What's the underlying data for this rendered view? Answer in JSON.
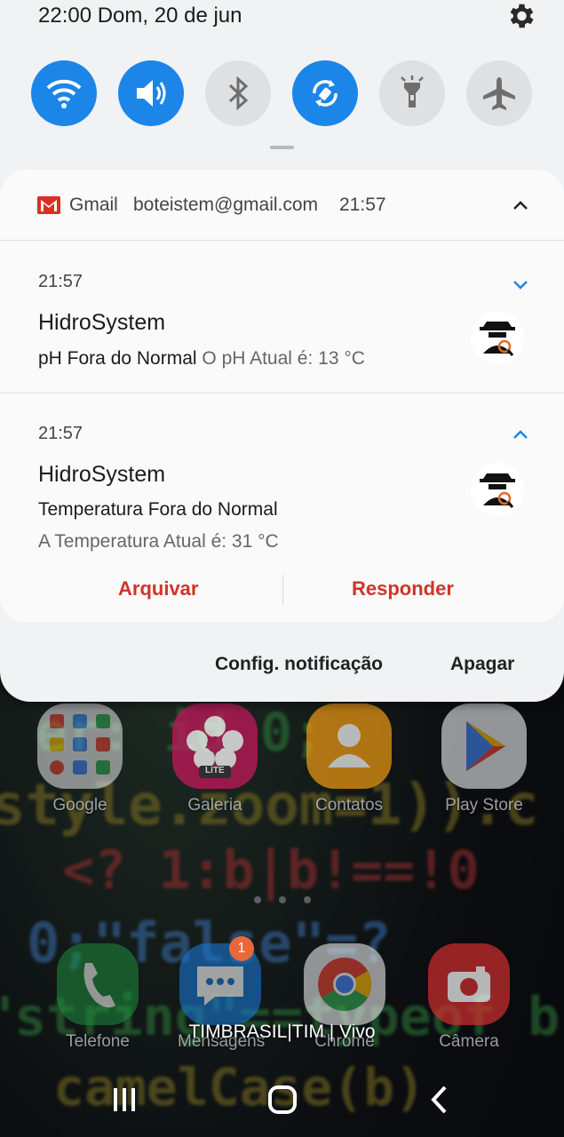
{
  "status": {
    "datetime": "22:00 Dom, 20 de jun",
    "settings_icon": "gear-icon"
  },
  "quick_settings": [
    {
      "name": "wifi",
      "icon": "wifi-icon",
      "on": true
    },
    {
      "name": "sound",
      "icon": "volume-icon",
      "on": true
    },
    {
      "name": "bluetooth",
      "icon": "bluetooth-icon",
      "on": false
    },
    {
      "name": "auto-rotate",
      "icon": "rotate-icon",
      "on": true
    },
    {
      "name": "flashlight",
      "icon": "flashlight-icon",
      "on": false
    },
    {
      "name": "airplane",
      "icon": "airplane-icon",
      "on": false
    }
  ],
  "gmail_group": {
    "app": "Gmail",
    "account": "boteistem@gmail.com",
    "time": "21:57",
    "notifications": [
      {
        "time": "21:57",
        "title": "HidroSystem",
        "subject": "pH Fora do Normal",
        "text": "O pH Atual é: 13 °C"
      },
      {
        "time": "21:57",
        "title": "HidroSystem",
        "subject": "Temperatura Fora do Normal",
        "text": "A Temperatura Atual é: 31 °C",
        "actions": [
          "Arquivar",
          "Responder"
        ]
      }
    ]
  },
  "footer": {
    "settings_label": "Config. notificação",
    "clear_label": "Apagar"
  },
  "home": {
    "apps_row1": [
      {
        "label": "Google",
        "icon": "google-folder-icon"
      },
      {
        "label": "Galeria",
        "icon": "gallery-icon",
        "sublabel": "LITE"
      },
      {
        "label": "Contatos",
        "icon": "contacts-icon"
      },
      {
        "label": "Play Store",
        "icon": "play-store-icon"
      }
    ],
    "apps_row2": [
      {
        "label": "Telefone",
        "icon": "phone-icon"
      },
      {
        "label": "Mensagens",
        "icon": "messages-icon",
        "badge": "1"
      },
      {
        "label": "Chrome",
        "icon": "chrome-icon"
      },
      {
        "label": "Câmera",
        "icon": "camera-icon"
      }
    ],
    "carrier": "TIMBRASIL|TIM | Vivo"
  },
  "colors": {
    "accent": "#1b86e8",
    "action": "#d1332c",
    "gmail_red": "#d93025"
  }
}
